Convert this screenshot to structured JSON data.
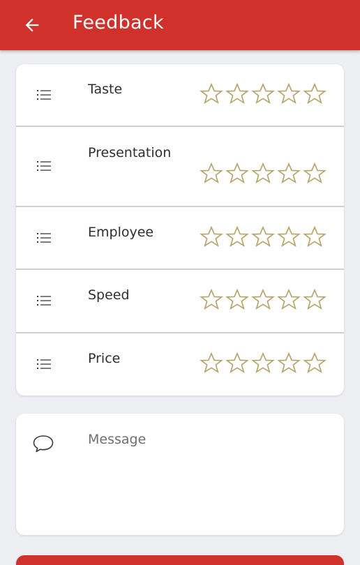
{
  "appbar": {
    "title": "Feedback",
    "back_icon": "arrow-left-icon",
    "color": "#d0322b"
  },
  "ratings": {
    "star_color": "#b5a46a",
    "max_stars": 5,
    "items": [
      {
        "label": "Taste",
        "icon": "list-icon",
        "rating": 0
      },
      {
        "label": "Presentation",
        "icon": "list-icon",
        "rating": 0
      },
      {
        "label": "Employee",
        "icon": "list-icon",
        "rating": 0
      },
      {
        "label": "Speed",
        "icon": "list-icon",
        "rating": 0
      },
      {
        "label": "Price",
        "icon": "list-icon",
        "rating": 0
      }
    ]
  },
  "message": {
    "icon": "chat-bubble-icon",
    "placeholder": "Message",
    "value": ""
  }
}
